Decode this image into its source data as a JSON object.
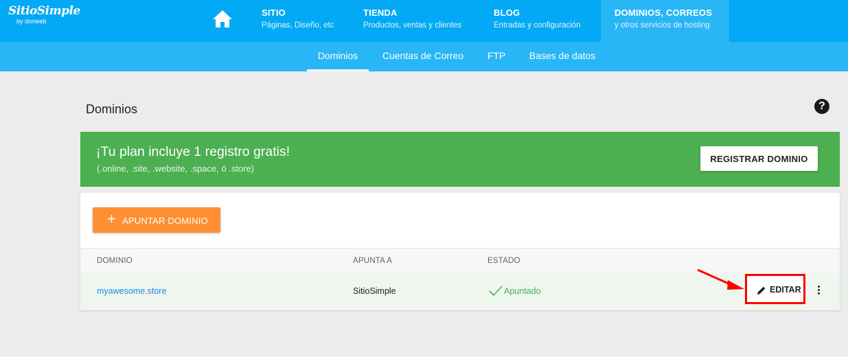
{
  "header": {
    "logo_main": "SitioSimple",
    "logo_sub": "by donweb",
    "nav": [
      {
        "title": "SITIO",
        "subtitle": "Páginas, Diseño, etc"
      },
      {
        "title": "TIENDA",
        "subtitle": "Productos, ventas y clientes"
      },
      {
        "title": "BLOG",
        "subtitle": "Entradas y configuración"
      },
      {
        "title": "DOMINIOS, CORREOS",
        "subtitle": "y otros servicios de hosting"
      }
    ],
    "home_icon": "home-icon"
  },
  "subnav": {
    "tabs": [
      "Dominios",
      "Cuentas de Correo",
      "FTP",
      "Bases de datos"
    ],
    "active": "Dominios"
  },
  "page": {
    "title": "Dominios",
    "help": "?"
  },
  "banner": {
    "heading": "¡Tu plan incluye 1 registro gratis!",
    "subtext": "(.online, .site, .website, .space, ó .store)",
    "button": "REGISTRAR DOMINIO"
  },
  "actions": {
    "add_label": "APUNTAR DOMINIO",
    "add_icon": "+"
  },
  "table": {
    "headers": [
      "DOMINIO",
      "APUNTA A",
      "ESTADO"
    ],
    "rows": [
      {
        "domain": "myawesome.store",
        "points_to": "SitioSimple",
        "status": "Apuntado",
        "edit_label": "EDITAR"
      }
    ]
  },
  "colors": {
    "primary": "#03a9f4",
    "secondary": "#29b6f6",
    "banner": "#4caf50",
    "accent": "#ff8f33",
    "highlight": "#ff0000"
  }
}
